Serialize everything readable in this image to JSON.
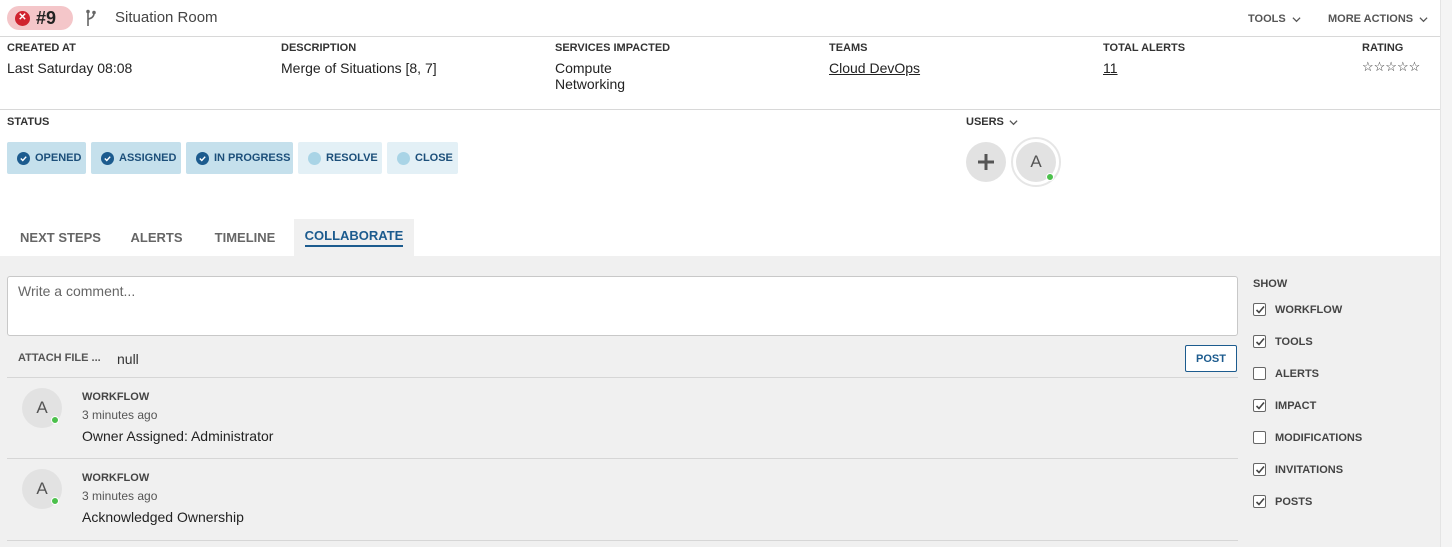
{
  "header": {
    "situation_id": "#9",
    "title": "Situation Room",
    "tools_label": "TOOLS",
    "more_actions_label": "MORE ACTIONS"
  },
  "info": {
    "created_at": {
      "label": "CREATED AT",
      "value": "Last Saturday 08:08"
    },
    "description": {
      "label": "DESCRIPTION",
      "value": "Merge of Situations [8, 7]"
    },
    "services": {
      "label": "SERVICES IMPACTED",
      "values": [
        "Compute",
        "Networking"
      ]
    },
    "teams": {
      "label": "TEAMS",
      "value": "Cloud DevOps"
    },
    "total_alerts": {
      "label": "TOTAL ALERTS",
      "value": "11"
    },
    "rating": {
      "label": "RATING",
      "stars": "☆☆☆☆☆",
      "value": 0,
      "max": 5
    }
  },
  "status": {
    "label": "STATUS",
    "steps": [
      {
        "label": "OPENED",
        "state": "done"
      },
      {
        "label": "ASSIGNED",
        "state": "done"
      },
      {
        "label": "IN PROGRESS",
        "state": "done"
      },
      {
        "label": "RESOLVE",
        "state": "pending"
      },
      {
        "label": "CLOSE",
        "state": "pending"
      }
    ]
  },
  "users": {
    "label": "USERS",
    "add_symbol": "+",
    "list": [
      {
        "initial": "A",
        "online": true
      }
    ]
  },
  "tabs": [
    {
      "label": "NEXT STEPS",
      "active": false
    },
    {
      "label": "ALERTS",
      "active": false
    },
    {
      "label": "TIMELINE",
      "active": false
    },
    {
      "label": "COLLABORATE",
      "active": true
    }
  ],
  "collaborate": {
    "comment_placeholder": "Write a comment...",
    "attach_label": "ATTACH FILE ...",
    "attach_value": "null",
    "post_label": "POST",
    "feed": [
      {
        "initial": "A",
        "category": "WORKFLOW",
        "time": "3 minutes ago",
        "message": "Owner Assigned: Administrator"
      },
      {
        "initial": "A",
        "category": "WORKFLOW",
        "time": "3 minutes ago",
        "message": "Acknowledged Ownership"
      }
    ],
    "show": {
      "label": "SHOW",
      "filters": [
        {
          "label": "WORKFLOW",
          "checked": true
        },
        {
          "label": "TOOLS",
          "checked": true
        },
        {
          "label": "ALERTS",
          "checked": false
        },
        {
          "label": "IMPACT",
          "checked": true
        },
        {
          "label": "MODIFICATIONS",
          "checked": false
        },
        {
          "label": "INVITATIONS",
          "checked": true
        },
        {
          "label": "POSTS",
          "checked": true
        }
      ]
    }
  },
  "colors": {
    "accent": "#1c5b8e",
    "badge_bg": "#f4c6c9",
    "badge_icon": "#d0232f",
    "status_done": "#c5e0ec",
    "status_pending": "#e3f0f6",
    "online": "#4cc04c"
  }
}
